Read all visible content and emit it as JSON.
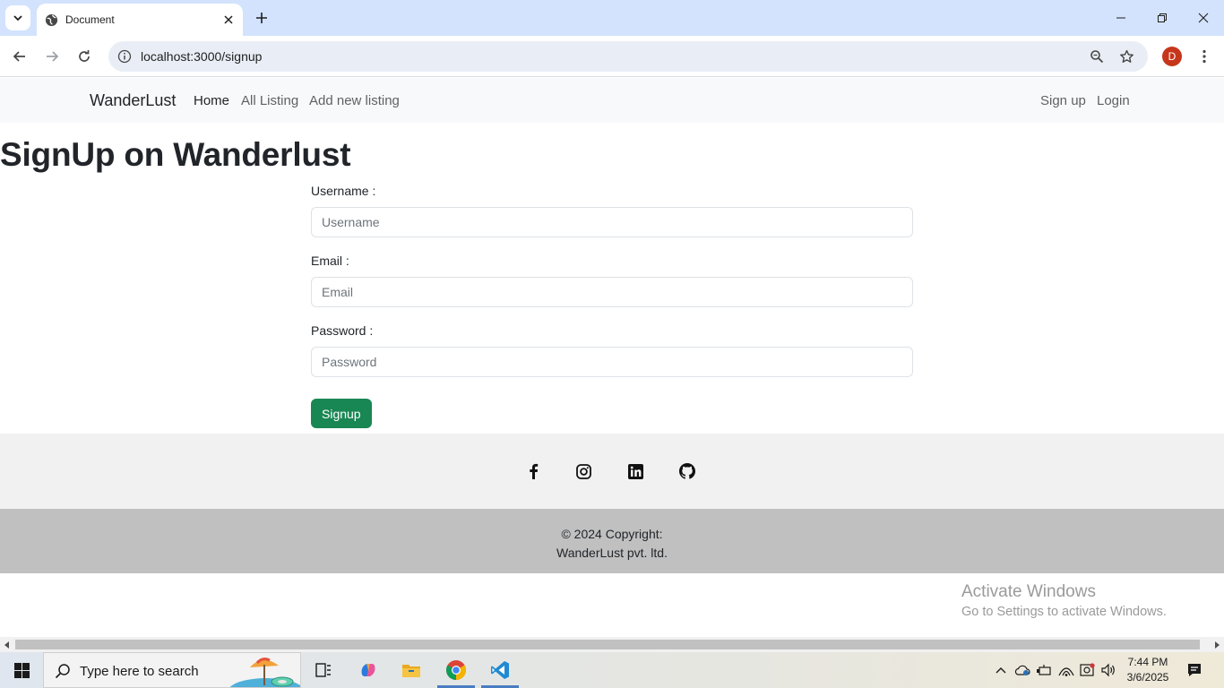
{
  "browser": {
    "tab_title": "Document",
    "url": "localhost:3000/signup",
    "profile_initial": "D"
  },
  "navbar": {
    "brand": "WanderLust",
    "links": [
      "Home",
      "All Listing",
      "Add new listing"
    ],
    "right_links": [
      "Sign up",
      "Login"
    ]
  },
  "page": {
    "title": "SignUp on Wanderlust"
  },
  "form": {
    "username_label": "Username :",
    "username_placeholder": "Username",
    "email_label": "Email :",
    "email_placeholder": "Email",
    "password_label": "Password :",
    "password_placeholder": "Password",
    "submit_label": "Signup"
  },
  "footer": {
    "social_icons": [
      "facebook-icon",
      "instagram-icon",
      "linkedin-icon",
      "github-icon"
    ],
    "copyright_line1": "© 2024 Copyright:",
    "copyright_line2": "WanderLust pvt. ltd."
  },
  "watermark": {
    "line1": "Activate Windows",
    "line2": "Go to Settings to activate Windows."
  },
  "taskbar": {
    "search_placeholder": "Type here to search",
    "time": "7:44 PM",
    "date": "3/6/2025"
  },
  "colors": {
    "tabstrip": "#d3e3fd",
    "navbar_bg": "#f8f9fa",
    "signup_button": "#198754",
    "footer_icons_bg": "#f1f1f1",
    "footer_copy_bg": "#c0c0c0",
    "profile_avatar": "#c5361b"
  }
}
